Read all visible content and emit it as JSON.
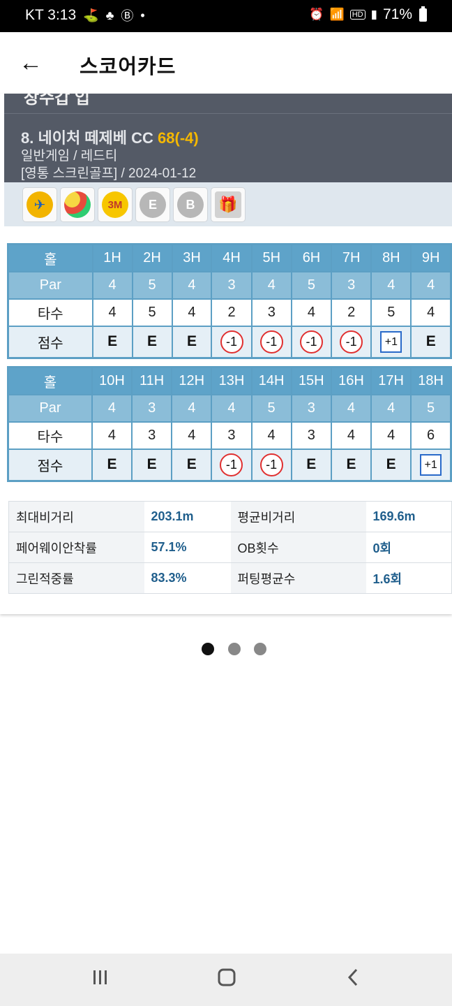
{
  "status_bar": {
    "carrier_time": "KT 3:13",
    "left_icons": [
      "golf-app-icon",
      "golf-app-icon-2",
      "b-app-icon",
      "dot-icon"
    ],
    "right_icons": [
      "alarm-icon",
      "wifi-icon",
      "hd-icon",
      "signal-icon"
    ],
    "battery": "71%"
  },
  "app_bar": {
    "title": "스코어카드",
    "back_icon": "back-arrow-icon"
  },
  "card": {
    "clipped_heading": "장수갑 입",
    "course_name": "8. 네이처 떼제베 CC",
    "course_score": "68(-4)",
    "game_type": "일반게임 / 레드티",
    "venue_date": "[영통 스크린골프] / 2024-01-12",
    "badges": [
      {
        "name": "bird-badge-icon",
        "label": "",
        "color": "#f2b400"
      },
      {
        "name": "balloon-badge-icon",
        "label": "",
        "color": "#e74c3c"
      },
      {
        "name": "3m-badge-icon",
        "label": "3M",
        "color": "#f7c600"
      },
      {
        "name": "e-badge-icon",
        "label": "E",
        "color": "#b7b7b7"
      },
      {
        "name": "b-badge-icon",
        "label": "B",
        "color": "#b7b7b7"
      },
      {
        "name": "gift-badge-icon",
        "label": "",
        "color": "#c8c8c8"
      }
    ]
  },
  "front_nine": {
    "hole_label": "홀",
    "par_label": "Par",
    "stroke_label": "타수",
    "score_label": "점수",
    "holes": [
      "1H",
      "2H",
      "3H",
      "4H",
      "5H",
      "6H",
      "7H",
      "8H",
      "9H"
    ],
    "par": [
      "4",
      "5",
      "4",
      "3",
      "4",
      "5",
      "3",
      "4",
      "4"
    ],
    "strokes": [
      "4",
      "5",
      "4",
      "2",
      "3",
      "4",
      "2",
      "5",
      "4"
    ],
    "scores": [
      {
        "text": "E",
        "type": "even"
      },
      {
        "text": "E",
        "type": "even"
      },
      {
        "text": "E",
        "type": "even"
      },
      {
        "text": "-1",
        "type": "birdie"
      },
      {
        "text": "-1",
        "type": "birdie"
      },
      {
        "text": "-1",
        "type": "birdie"
      },
      {
        "text": "-1",
        "type": "birdie"
      },
      {
        "text": "+1",
        "type": "bogey"
      },
      {
        "text": "E",
        "type": "even"
      }
    ]
  },
  "back_nine": {
    "hole_label": "홀",
    "par_label": "Par",
    "stroke_label": "타수",
    "score_label": "점수",
    "holes": [
      "10H",
      "11H",
      "12H",
      "13H",
      "14H",
      "15H",
      "16H",
      "17H",
      "18H"
    ],
    "par": [
      "4",
      "3",
      "4",
      "4",
      "5",
      "3",
      "4",
      "4",
      "5"
    ],
    "strokes": [
      "4",
      "3",
      "4",
      "3",
      "4",
      "3",
      "4",
      "4",
      "6"
    ],
    "scores": [
      {
        "text": "E",
        "type": "even"
      },
      {
        "text": "E",
        "type": "even"
      },
      {
        "text": "E",
        "type": "even"
      },
      {
        "text": "-1",
        "type": "birdie"
      },
      {
        "text": "-1",
        "type": "birdie"
      },
      {
        "text": "E",
        "type": "even"
      },
      {
        "text": "E",
        "type": "even"
      },
      {
        "text": "E",
        "type": "even"
      },
      {
        "text": "+1",
        "type": "bogey"
      }
    ]
  },
  "stats": [
    {
      "label1": "최대비거리",
      "value1": "203.1m",
      "label2": "평균비거리",
      "value2": "169.6m"
    },
    {
      "label1": "페어웨이안착률",
      "value1": "57.1%",
      "label2": "OB횟수",
      "value2": "0회"
    },
    {
      "label1": "그린적중률",
      "value1": "83.3%",
      "label2": "퍼팅평균수",
      "value2": "1.6회"
    }
  ],
  "pager": {
    "count": 3,
    "active_index": 0
  },
  "nav_bar": {
    "recent_icon": "recent-apps-icon",
    "home_icon": "home-icon",
    "back_icon": "nav-back-icon"
  }
}
